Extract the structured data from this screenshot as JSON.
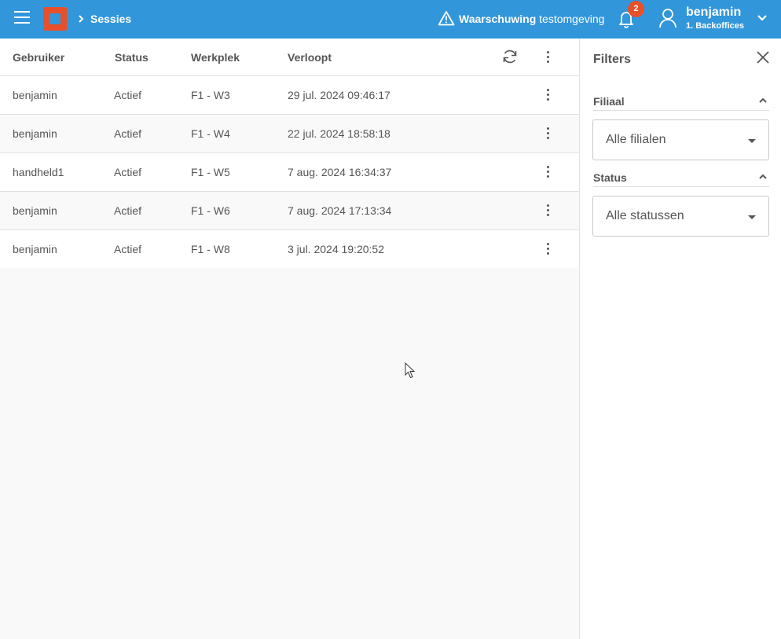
{
  "header": {
    "breadcrumb": "Sessies",
    "warning_bold": "Waarschuwing",
    "warning_text": "testomgeving",
    "notification_count": "2",
    "user_name": "benjamin",
    "user_org": "1. Backoffices",
    "accent_color": "#3296db",
    "brand_color": "#e8502a"
  },
  "table": {
    "columns": [
      "Gebruiker",
      "Status",
      "Werkplek",
      "Verloopt"
    ],
    "rows": [
      {
        "user": "benjamin",
        "status": "Actief",
        "workplace": "F1 - W3",
        "expires": "29 jul. 2024 09:46:17"
      },
      {
        "user": "benjamin",
        "status": "Actief",
        "workplace": "F1 - W4",
        "expires": "22 jul. 2024 18:58:18"
      },
      {
        "user": "handheld1",
        "status": "Actief",
        "workplace": "F1 - W5",
        "expires": "7 aug. 2024 16:34:37"
      },
      {
        "user": "benjamin",
        "status": "Actief",
        "workplace": "F1 - W6",
        "expires": "7 aug. 2024 17:13:34"
      },
      {
        "user": "benjamin",
        "status": "Actief",
        "workplace": "F1 - W8",
        "expires": "3 jul. 2024 19:20:52"
      }
    ]
  },
  "filters": {
    "title": "Filters",
    "branch_label": "Filiaal",
    "branch_value": "Alle filialen",
    "status_label": "Status",
    "status_value": "Alle statussen"
  },
  "icons": [
    "menu-icon",
    "logo-icon",
    "chevron-right-icon",
    "warning-icon",
    "bell-icon",
    "user-icon",
    "chevron-down-icon",
    "refresh-icon",
    "more-vertical-icon",
    "close-icon",
    "chevron-up-icon"
  ]
}
